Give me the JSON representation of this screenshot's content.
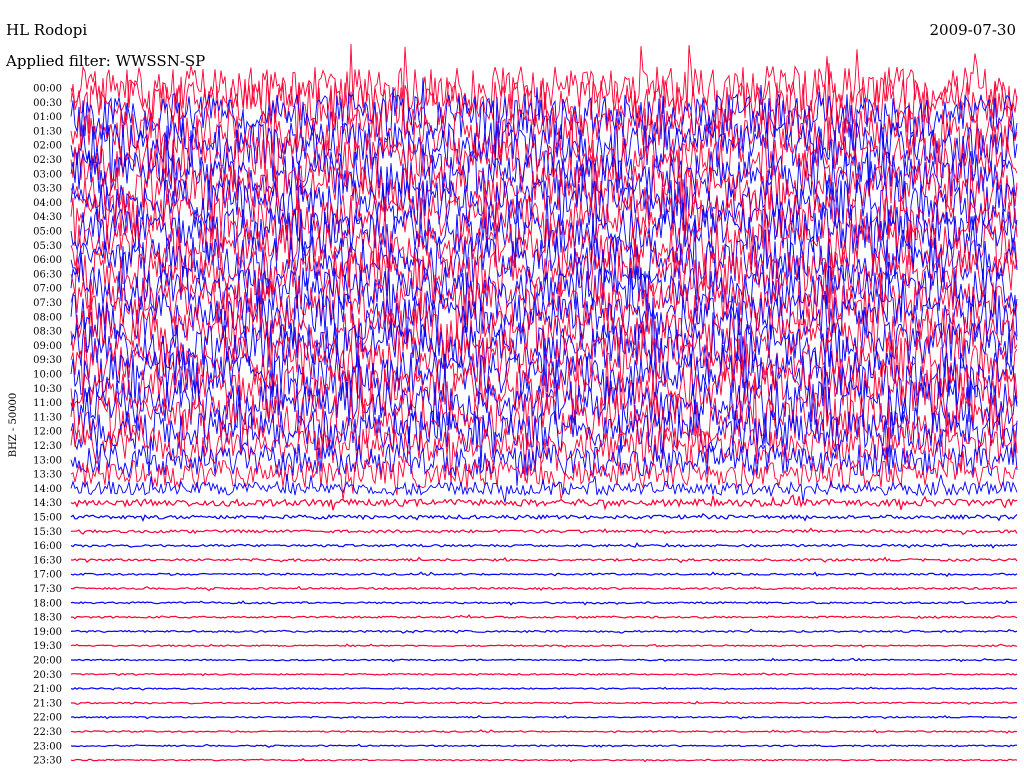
{
  "header": {
    "station": "HL Rodopi",
    "date": "2009-07-30",
    "filter": "Applied filter: WWSSN-SP"
  },
  "channel_label": "BHZ - 50000",
  "colors": {
    "trace_a": "#ff0033",
    "trace_b": "#0000ff",
    "background": "#ffffff",
    "text": "#000000"
  },
  "chart_data": {
    "type": "line",
    "title": "HL Rodopi",
    "subtitle": "Applied filter: WWSSN-SP",
    "ylabel": "BHZ - 50000",
    "xlabel": "",
    "grid": false,
    "trace_colors_alternate": [
      "trace_a",
      "trace_b"
    ],
    "rows": [
      {
        "time": "00:00",
        "amplitude": 1.0,
        "color": "trace_a"
      },
      {
        "time": "00:30",
        "amplitude": 1.0,
        "color": "trace_a"
      },
      {
        "time": "01:00",
        "amplitude": 1.0,
        "color": "trace_b"
      },
      {
        "time": "01:30",
        "amplitude": 1.0,
        "color": "trace_a"
      },
      {
        "time": "02:00",
        "amplitude": 1.0,
        "color": "trace_b"
      },
      {
        "time": "02:30",
        "amplitude": 1.0,
        "color": "trace_a"
      },
      {
        "time": "03:00",
        "amplitude": 1.0,
        "color": "trace_b"
      },
      {
        "time": "03:30",
        "amplitude": 1.0,
        "color": "trace_a"
      },
      {
        "time": "04:00",
        "amplitude": 1.0,
        "color": "trace_b"
      },
      {
        "time": "04:30",
        "amplitude": 1.0,
        "color": "trace_a"
      },
      {
        "time": "05:00",
        "amplitude": 1.0,
        "color": "trace_b"
      },
      {
        "time": "05:30",
        "amplitude": 1.0,
        "color": "trace_a"
      },
      {
        "time": "06:00",
        "amplitude": 1.0,
        "color": "trace_b"
      },
      {
        "time": "06:30",
        "amplitude": 1.0,
        "color": "trace_a"
      },
      {
        "time": "07:00",
        "amplitude": 1.0,
        "color": "trace_b"
      },
      {
        "time": "07:30",
        "amplitude": 1.0,
        "color": "trace_a"
      },
      {
        "time": "08:00",
        "amplitude": 1.0,
        "color": "trace_b"
      },
      {
        "time": "08:30",
        "amplitude": 1.0,
        "color": "trace_a"
      },
      {
        "time": "09:00",
        "amplitude": 1.0,
        "color": "trace_b"
      },
      {
        "time": "09:30",
        "amplitude": 1.0,
        "color": "trace_a"
      },
      {
        "time": "10:00",
        "amplitude": 1.0,
        "color": "trace_b"
      },
      {
        "time": "10:30",
        "amplitude": 1.0,
        "color": "trace_a"
      },
      {
        "time": "11:00",
        "amplitude": 1.0,
        "color": "trace_b"
      },
      {
        "time": "11:30",
        "amplitude": 1.0,
        "color": "trace_a"
      },
      {
        "time": "12:00",
        "amplitude": 0.9,
        "color": "trace_b"
      },
      {
        "time": "12:30",
        "amplitude": 0.8,
        "color": "trace_a"
      },
      {
        "time": "13:00",
        "amplitude": 0.7,
        "color": "trace_b"
      },
      {
        "time": "13:30",
        "amplitude": 0.6,
        "color": "trace_a"
      },
      {
        "time": "14:00",
        "amplitude": 0.3,
        "color": "trace_b"
      },
      {
        "time": "14:30",
        "amplitude": 0.15,
        "color": "trace_a"
      },
      {
        "time": "15:00",
        "amplitude": 0.08,
        "color": "trace_b"
      },
      {
        "time": "15:30",
        "amplitude": 0.06,
        "color": "trace_a"
      },
      {
        "time": "16:00",
        "amplitude": 0.05,
        "color": "trace_b"
      },
      {
        "time": "16:30",
        "amplitude": 0.05,
        "color": "trace_a"
      },
      {
        "time": "17:00",
        "amplitude": 0.04,
        "color": "trace_b"
      },
      {
        "time": "17:30",
        "amplitude": 0.04,
        "color": "trace_a"
      },
      {
        "time": "18:00",
        "amplitude": 0.04,
        "color": "trace_b"
      },
      {
        "time": "18:30",
        "amplitude": 0.04,
        "color": "trace_a"
      },
      {
        "time": "19:00",
        "amplitude": 0.04,
        "color": "trace_b"
      },
      {
        "time": "19:30",
        "amplitude": 0.03,
        "color": "trace_a"
      },
      {
        "time": "20:00",
        "amplitude": 0.03,
        "color": "trace_b"
      },
      {
        "time": "20:30",
        "amplitude": 0.03,
        "color": "trace_a"
      },
      {
        "time": "21:00",
        "amplitude": 0.03,
        "color": "trace_b"
      },
      {
        "time": "21:30",
        "amplitude": 0.03,
        "color": "trace_a"
      },
      {
        "time": "22:00",
        "amplitude": 0.03,
        "color": "trace_b"
      },
      {
        "time": "22:30",
        "amplitude": 0.03,
        "color": "trace_a"
      },
      {
        "time": "23:00",
        "amplitude": 0.03,
        "color": "trace_b"
      },
      {
        "time": "23:30",
        "amplitude": 0.03,
        "color": "trace_a"
      }
    ]
  }
}
